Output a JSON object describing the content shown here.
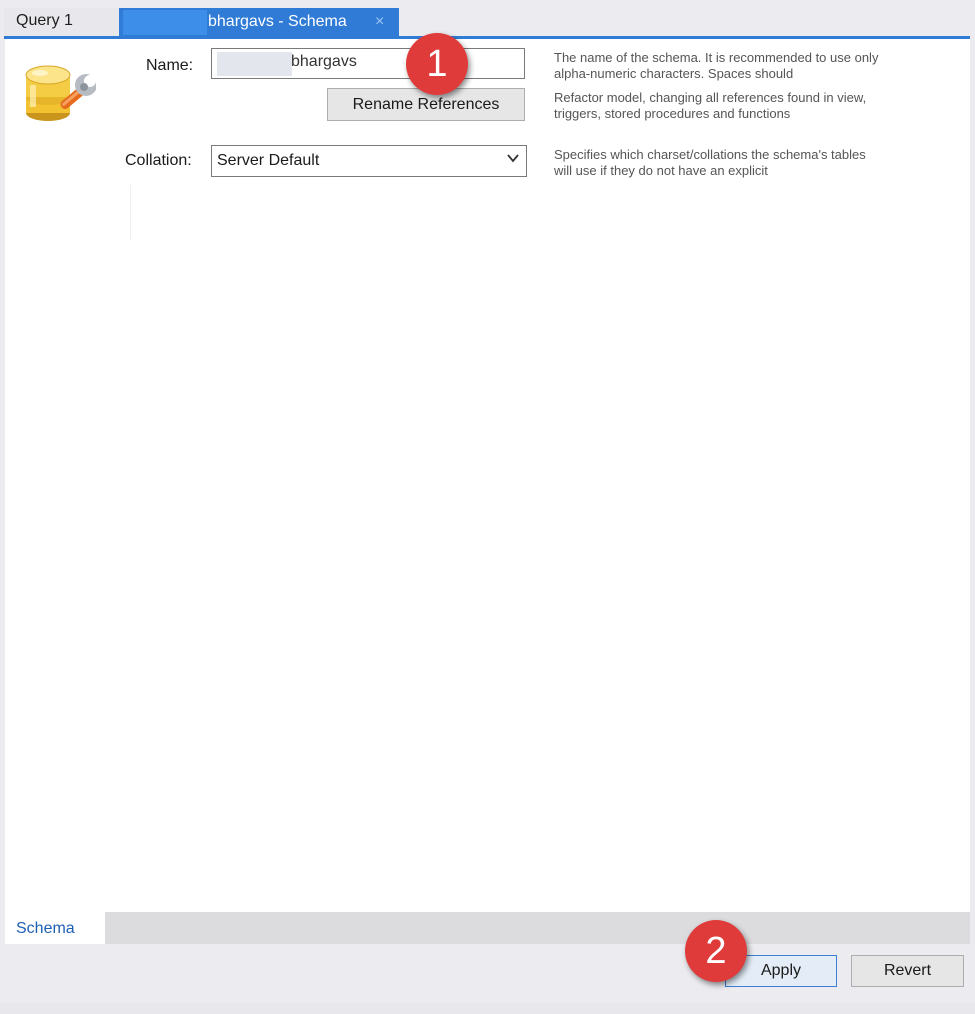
{
  "tabs": {
    "query": "Query 1",
    "schema": "bhargavs - Schema",
    "close": "×"
  },
  "form": {
    "name_label": "Name:",
    "name_value": "bhargavs",
    "rename_button": "Rename References",
    "collation_label": "Collation:",
    "collation_value": "Server Default"
  },
  "help": {
    "name": "The name of the schema. It is recommended to use only alpha-numeric characters. Spaces should",
    "rename": "Refactor model, changing all references found in view, triggers, stored procedures and functions",
    "collation": "Specifies which charset/collations the schema's tables will use if they do not have an explicit"
  },
  "subtabs": {
    "schema": "Schema"
  },
  "buttons": {
    "apply": "Apply",
    "revert": "Revert"
  },
  "badges": {
    "one": "1",
    "two": "2"
  },
  "icons": {
    "schema": "database-wrench-icon",
    "dropdown": "chevron-down-icon"
  },
  "colors": {
    "accent": "#2f7bd6",
    "badge": "#e03b3b"
  }
}
